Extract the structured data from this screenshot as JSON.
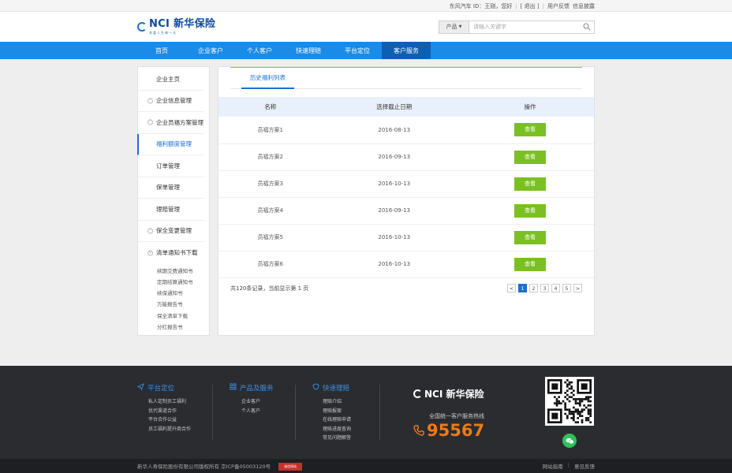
{
  "topbar": {
    "greeting": "东风汽车 ID：王刚，您好",
    "logout": "[ 退出 ]",
    "feedback": "用户反馈",
    "info": "信息披露"
  },
  "brand": {
    "name": "NCI 新华保险",
    "slogan": "关爱人生每一天"
  },
  "search": {
    "category": "产品",
    "placeholder": "请输入关键字"
  },
  "nav": {
    "items": [
      {
        "label": "首页"
      },
      {
        "label": "企业客户"
      },
      {
        "label": "个人客户"
      },
      {
        "label": "快速理赔"
      },
      {
        "label": "平台定位"
      },
      {
        "label": "客户服务"
      }
    ]
  },
  "sidebar": {
    "items": [
      {
        "label": "企业主页"
      },
      {
        "label": "企业信息管理"
      },
      {
        "label": "企业员福方案管理"
      },
      {
        "label": "福利额度管理"
      },
      {
        "label": "订单管理"
      },
      {
        "label": "保单管理"
      },
      {
        "label": "理赔管理"
      },
      {
        "label": "保全变更管理"
      },
      {
        "label": "清单通知书下载"
      }
    ],
    "sub_items": [
      {
        "label": "续期交费通知书"
      },
      {
        "label": "定期结算通知书"
      },
      {
        "label": "续保通知书"
      },
      {
        "label": "万能报告书"
      },
      {
        "label": "保全清单下载"
      },
      {
        "label": "分红报告书"
      }
    ]
  },
  "content": {
    "tab": "历史福利列表",
    "columns": [
      "名称",
      "选择截止日期",
      "操作"
    ],
    "rows": [
      {
        "name": "员福方案1",
        "date": "2016-08-13",
        "action": "查看"
      },
      {
        "name": "员福方案2",
        "date": "2016-09-13",
        "action": "查看"
      },
      {
        "name": "员福方案3",
        "date": "2016-10-13",
        "action": "查看"
      },
      {
        "name": "员福方案4",
        "date": "2016-09-13",
        "action": "查看"
      },
      {
        "name": "员福方案5",
        "date": "2016-10-13",
        "action": "查看"
      },
      {
        "name": "员福方案6",
        "date": "2016-10-13",
        "action": "查看"
      }
    ],
    "pager_info": "共120条记录，当前显示第 1 页",
    "pages": [
      "1",
      "2",
      "3",
      "4",
      "5"
    ],
    "current_page": "1"
  },
  "footer": {
    "col1": {
      "title": "平台定位",
      "items": [
        "私人定制员工福利",
        "优代渠道合作",
        "平台合作公益",
        "员工福利提升商合作"
      ]
    },
    "col2": {
      "title": "产品及服务",
      "items": [
        "企业客户",
        "个人客户"
      ]
    },
    "col3": {
      "title": "快速理赔",
      "items": [
        "理赔介绍",
        "理赔报案",
        "在线理赔申请",
        "理赔进度查询",
        "常见问题解答"
      ]
    },
    "brand": "NCI 新华保险",
    "hotline_label": "全国统一客户服务热线",
    "hotline": "95567",
    "copyright": "新华人寿保险股份有限公司版权所有  京ICP备05003120号",
    "badge": "诚信网站",
    "link_guide": "网站指南",
    "link_feedback": "意见反馈"
  },
  "colors": {
    "nav_blue": "#1b8be8",
    "nav_active": "#0d5fb3",
    "accent_blue": "#1b6fd0",
    "button_green": "#7bc022",
    "hotline_orange": "#f07a16",
    "footer_bg": "#2a2c30"
  }
}
